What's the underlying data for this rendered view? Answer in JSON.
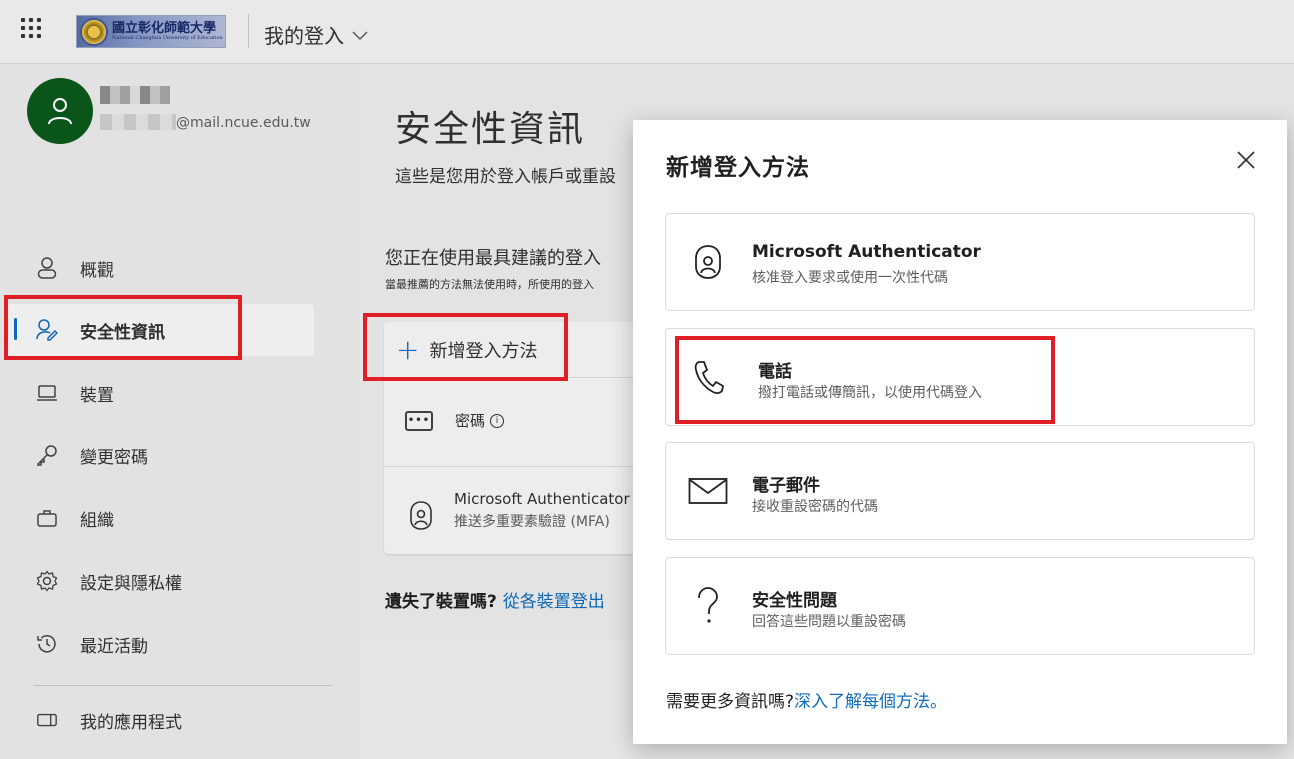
{
  "header": {
    "app_title": "我的登入",
    "logo_text": "國立彰化師範大學",
    "logo_subtext": "National Changhua University of Education"
  },
  "sidebar": {
    "user_email": "@mail.ncue.edu.tw",
    "items": [
      {
        "label": "概觀",
        "icon": "person-icon"
      },
      {
        "label": "安全性資訊",
        "icon": "security-info-icon",
        "active": true
      },
      {
        "label": "裝置",
        "icon": "laptop-icon"
      },
      {
        "label": "變更密碼",
        "icon": "key-icon"
      },
      {
        "label": "組織",
        "icon": "briefcase-icon"
      },
      {
        "label": "設定與隱私權",
        "icon": "gear-icon"
      },
      {
        "label": "最近活動",
        "icon": "history-icon"
      },
      {
        "label": "我的應用程式",
        "icon": "apps-icon"
      }
    ]
  },
  "main": {
    "title": "安全性資訊",
    "description": "這些是您用於登入帳戶或重設",
    "default_method_line": "您正在使用最具建議的登入",
    "default_method_sub": "當最推薦的方法無法使用時，所使用的登入",
    "add_method_label": "新增登入方法",
    "methods": [
      {
        "name": "密碼",
        "detail": ""
      },
      {
        "name": "Microsoft Authenticator",
        "detail": "推送多重要素驗證 (MFA)"
      }
    ],
    "lost_device_question": "遺失了裝置嗎?",
    "lost_device_link": "從各裝置登出"
  },
  "dialog": {
    "title": "新增登入方法",
    "options": [
      {
        "title": "Microsoft Authenticator",
        "subtitle": "核准登入要求或使用一次性代碼",
        "icon": "authenticator-icon"
      },
      {
        "title": "電話",
        "subtitle": "撥打電話或傳簡訊，以使用代碼登入",
        "icon": "phone-icon"
      },
      {
        "title": "電子郵件",
        "subtitle": "接收重設密碼的代碼",
        "icon": "mail-icon"
      },
      {
        "title": "安全性問題",
        "subtitle": "回答這些問題以重設密碼",
        "icon": "question-icon"
      }
    ],
    "footer_text": "需要更多資訊嗎?",
    "footer_link": "深入了解每個方法。"
  },
  "colors": {
    "accent": "#0f6cbd",
    "highlight": "#e01e25",
    "avatar": "#0b5a1c"
  }
}
